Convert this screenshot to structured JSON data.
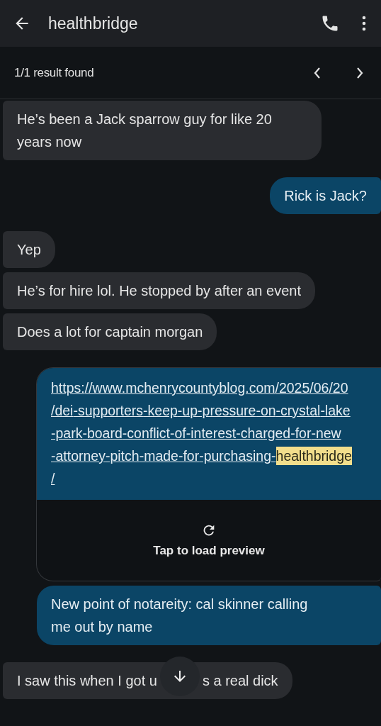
{
  "header": {
    "title": "healthbridge"
  },
  "search": {
    "result": "1/1 result found"
  },
  "messages": [
    {
      "kind": "incoming",
      "text": "He’s been a Jack sparrow guy for like 20 years now"
    },
    {
      "kind": "outgoing",
      "text": "Rick is Jack?"
    },
    {
      "kind": "incoming",
      "text": "Yep"
    },
    {
      "kind": "incoming",
      "text": "He’s for hire lol. He stopped by after an event"
    },
    {
      "kind": "incoming",
      "text": "Does a lot for captain morgan"
    },
    {
      "kind": "link",
      "url_before": "https://www.mchenrycountyblog.com/2025/06/20/dei-supporters-keep-up-pressure-on-crystal-lake-park-board-conflict-of-interest-charged-for-new-attorney-pitch-made-for-purchasing-",
      "highlight": "healthbridge",
      "url_after": "/",
      "preview": "Tap to load preview"
    },
    {
      "kind": "outgoing",
      "text": "New point of notareity: cal skinner calling me out by name"
    },
    {
      "kind": "covered",
      "text_before": "I saw this when I got u",
      "text_after": "s a real dick"
    }
  ]
}
